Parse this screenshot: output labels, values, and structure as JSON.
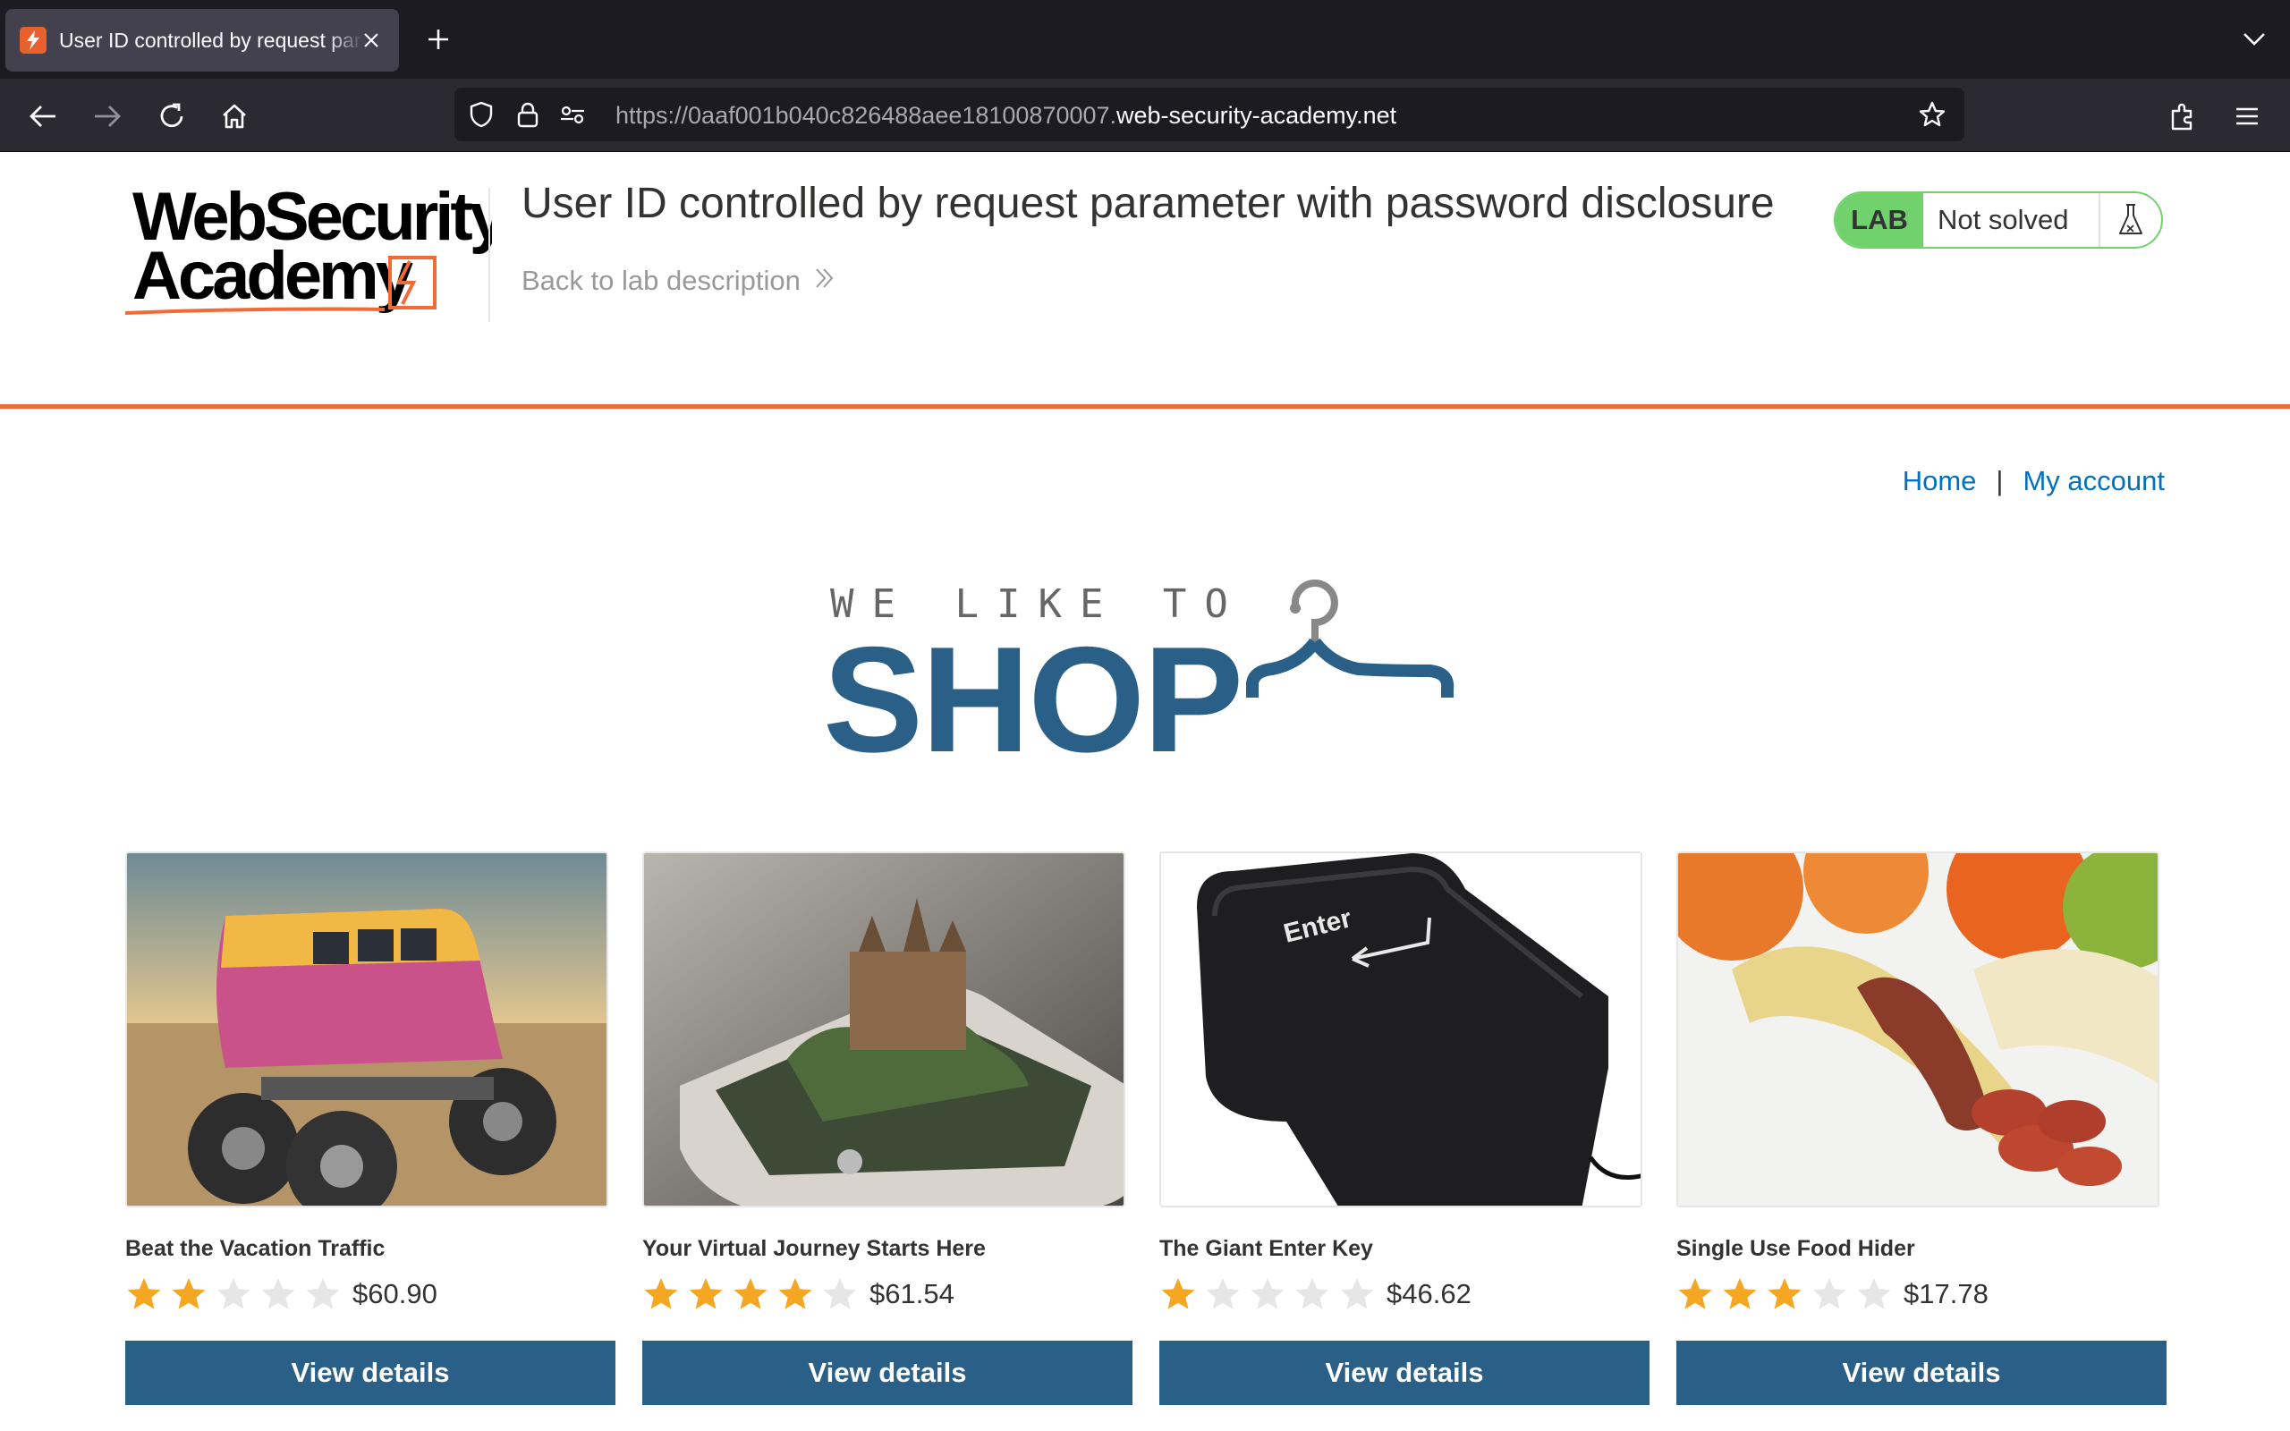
{
  "browser": {
    "tab_title": "User ID controlled by request parameter with password disclosure",
    "url_dim": "https://0aaf001b040c826488aee18100870007.",
    "url_main": "web-security-academy.net"
  },
  "header": {
    "logo_line1": "WebSecurity",
    "logo_line2": "Academy",
    "lab_title": "User ID controlled by request parameter with password disclosure",
    "back_link": "Back to lab description",
    "lab_label": "LAB",
    "lab_status": "Not solved"
  },
  "nav": {
    "home": "Home",
    "separator": "|",
    "my_account": "My account"
  },
  "hero": {
    "small": "WE LIKE TO",
    "big": "SHOP"
  },
  "products": [
    {
      "name": "Beat the Vacation Traffic",
      "rating": 2,
      "price": "$60.90",
      "button": "View details"
    },
    {
      "name": "Your Virtual Journey Starts Here",
      "rating": 4,
      "price": "$61.54",
      "button": "View details"
    },
    {
      "name": "The Giant Enter Key",
      "rating": 1,
      "price": "$46.62",
      "button": "View details"
    },
    {
      "name": "Single Use Food Hider",
      "rating": 3,
      "price": "$17.78",
      "button": "View details"
    }
  ],
  "images": {
    "enter_key_label": "Enter"
  },
  "colors": {
    "accent_orange": "#f26b36",
    "brand_blue": "#2a5f88",
    "link_blue": "#0071bc",
    "lab_green": "#70d16d",
    "star_gold": "#f5a623",
    "star_empty": "#e6e6e6"
  }
}
